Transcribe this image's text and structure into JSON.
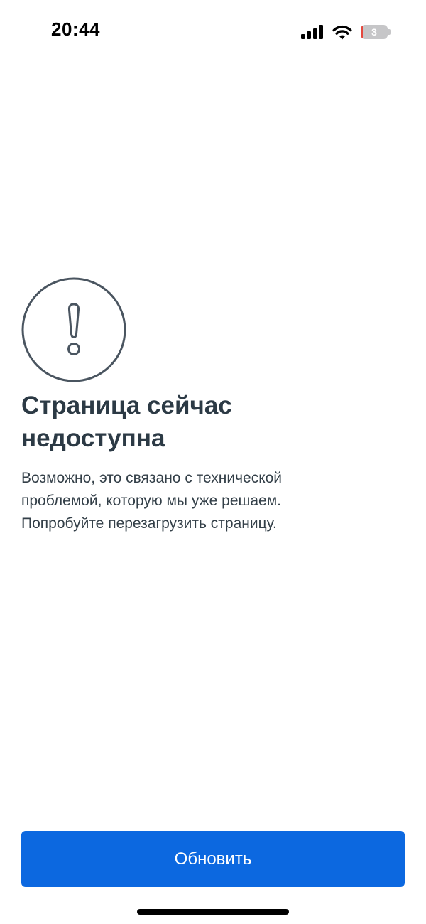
{
  "status_bar": {
    "time": "20:44",
    "battery_level": "3",
    "signal_icon": "cellular-signal-icon",
    "wifi_icon": "wifi-icon",
    "battery_icon": "battery-icon",
    "battery_color": "#c6c6c8",
    "battery_low_color": "#e5483e"
  },
  "error": {
    "icon": "exclamation-circle-icon",
    "title_lines": [
      "Страница сейчас",
      "недоступна"
    ],
    "description_lines": [
      "Возможно, это связано с технической",
      "проблемой, которую мы уже решаем.",
      "Попробуйте перезагрузить страницу."
    ]
  },
  "actions": {
    "refresh_label": "Обновить"
  },
  "colors": {
    "primary": "#0c68e0",
    "title_text": "#2c3a45",
    "body_text": "#333f48",
    "icon_stroke": "#4a5560",
    "background": "#ffffff"
  }
}
